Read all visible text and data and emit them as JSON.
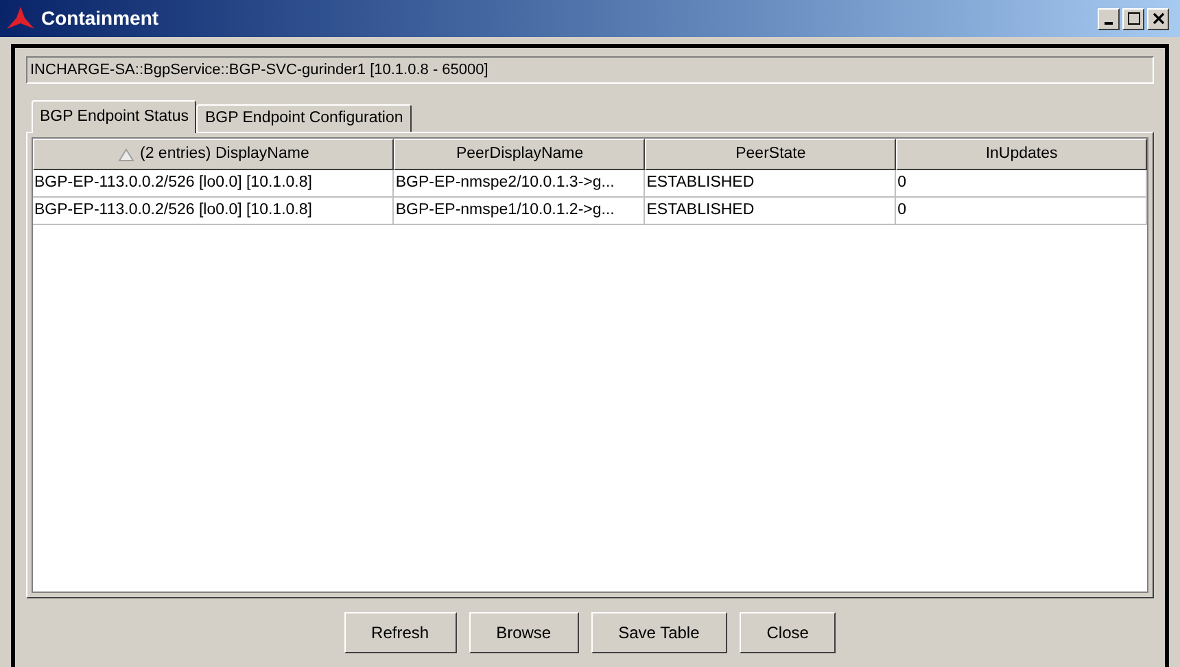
{
  "window": {
    "title": "Containment"
  },
  "path": "INCHARGE-SA::BgpService::BGP-SVC-gurinder1 [10.1.0.8 - 65000]",
  "tabs": [
    {
      "label": "BGP Endpoint Status",
      "selected": true
    },
    {
      "label": "BGP Endpoint Configuration",
      "selected": false
    }
  ],
  "table": {
    "columns": [
      "(2 entries) DisplayName",
      "PeerDisplayName",
      "PeerState",
      "InUpdates"
    ],
    "rows": [
      [
        "BGP-EP-113.0.0.2/526 [lo0.0] [10.1.0.8]",
        "BGP-EP-nmspe2/10.0.1.3->g...",
        "ESTABLISHED",
        "0"
      ],
      [
        "BGP-EP-113.0.0.2/526 [lo0.0] [10.1.0.8]",
        "BGP-EP-nmspe1/10.0.1.2->g...",
        "ESTABLISHED",
        "0"
      ]
    ]
  },
  "buttons": [
    "Refresh",
    "Browse",
    "Save Table",
    "Close"
  ]
}
